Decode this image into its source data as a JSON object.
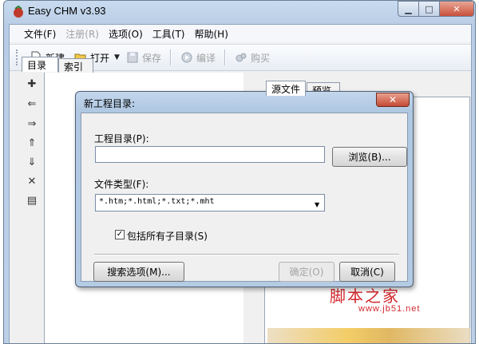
{
  "window": {
    "title": "Easy CHM v3.93"
  },
  "menu": [
    "文件(F)",
    "注册(R)",
    "选项(O)",
    "工具(T)",
    "帮助(H)"
  ],
  "menu_disabled": [
    false,
    true,
    false,
    false,
    false
  ],
  "toolbar": {
    "new_label": "新建",
    "open_label": "打开",
    "save_label": "保存",
    "compile_label": "编译",
    "buy_label": "购买"
  },
  "left_tabs": [
    "目录",
    "索引"
  ],
  "right_tabs": [
    "源文件",
    "预览"
  ],
  "left_tools": [
    "add-icon",
    "arrow-left-icon",
    "arrow-right-icon",
    "arrow-up-icon",
    "arrow-down-icon",
    "delete-icon",
    "properties-icon"
  ],
  "dialog": {
    "title": "新工程目录:",
    "project_dir_label": "工程目录(P):",
    "project_dir_value": "",
    "browse_label": "浏览(B)...",
    "file_type_label": "文件类型(F):",
    "file_type_value": "*.htm;*.html;*.txt;*.mht",
    "include_subdirs_label": "包括所有子目录(S)",
    "include_subdirs_checked": true,
    "search_options_label": "搜索选项(M)...",
    "ok_label": "确定(O)",
    "cancel_label": "取消(C)"
  },
  "watermark": {
    "text": "脚本之家",
    "url": "www.jb51.net"
  }
}
